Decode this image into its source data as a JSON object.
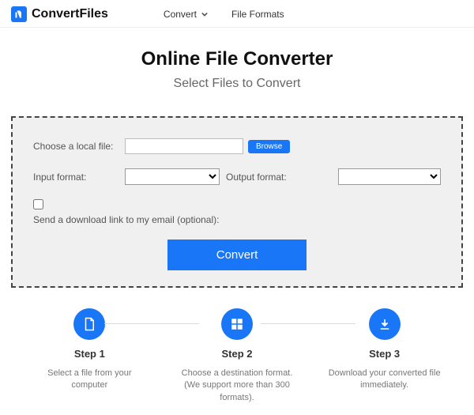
{
  "brand": {
    "name": "ConvertFiles"
  },
  "nav": {
    "convert": "Convert",
    "formats": "File Formats"
  },
  "page": {
    "title": "Online File Converter",
    "subtitle": "Select Files to Convert"
  },
  "form": {
    "choose_label": "Choose a local file:",
    "file_value": "",
    "browse": "Browse",
    "input_format_label": "Input format:",
    "input_format_value": "",
    "output_format_label": "Output format:",
    "output_format_value": "",
    "email_checkbox_label": "Send a download link to my email (optional):",
    "convert_button": "Convert"
  },
  "steps": [
    {
      "title": "Step 1",
      "desc": "Select a file from your computer"
    },
    {
      "title": "Step 2",
      "desc": "Choose a destination format. (We support more than 300 formats)."
    },
    {
      "title": "Step 3",
      "desc": "Download your converted file immediately."
    }
  ]
}
